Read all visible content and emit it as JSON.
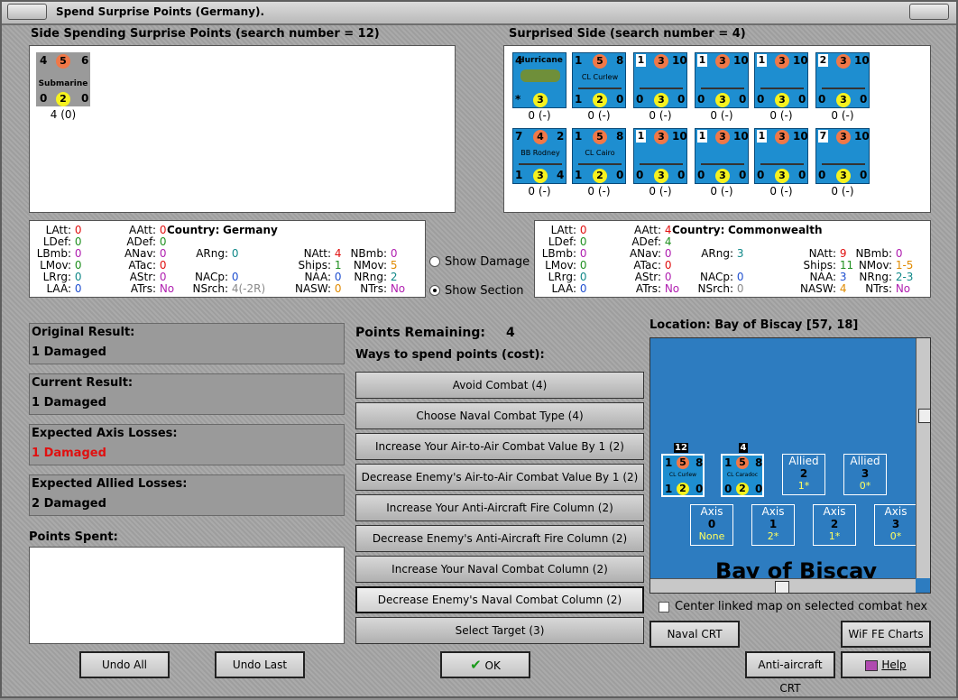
{
  "window": {
    "title": "Spend Surprise Points (Germany)."
  },
  "spending_side": {
    "heading": "Side Spending Surprise Points (search number = 12)",
    "units": [
      {
        "top_left": "4",
        "top_mid": "5",
        "top_right": "6",
        "name": "Submarine",
        "bot_left": "0",
        "bot_mid": "2",
        "bot_right": "0",
        "value": "4 (0)"
      }
    ]
  },
  "surprised_side": {
    "heading": "Surprised Side (search number = 4)",
    "units": [
      {
        "tl": "4",
        "tm": "",
        "tr": "",
        "name": "Hurricane",
        "bl": "*",
        "bm": "3",
        "br": "",
        "value": "0 (-)",
        "kind": "air"
      },
      {
        "tl": "1",
        "tm": "5",
        "tr": "8",
        "name": "CL Curlew",
        "bl": "1",
        "bm": "2",
        "br": "0",
        "value": "0 (-)",
        "kind": "ship"
      },
      {
        "tl": "1",
        "tm": "3",
        "tr": "10",
        "name": "",
        "bl": "0",
        "bm": "3",
        "br": "0",
        "value": "0 (-)",
        "kind": "ship"
      },
      {
        "tl": "1",
        "tm": "3",
        "tr": "10",
        "name": "",
        "bl": "0",
        "bm": "3",
        "br": "0",
        "value": "0 (-)",
        "kind": "ship"
      },
      {
        "tl": "1",
        "tm": "3",
        "tr": "10",
        "name": "",
        "bl": "0",
        "bm": "3",
        "br": "0",
        "value": "0 (-)",
        "kind": "ship"
      },
      {
        "tl": "2",
        "tm": "3",
        "tr": "10",
        "name": "",
        "bl": "0",
        "bm": "3",
        "br": "0",
        "value": "0 (-)",
        "kind": "ship"
      },
      {
        "tl": "7",
        "tm": "4",
        "tr": "2",
        "name": "BB Rodney",
        "bl": "1",
        "bm": "3",
        "br": "4",
        "value": "0 (-)",
        "kind": "ship"
      },
      {
        "tl": "1",
        "tm": "5",
        "tr": "8",
        "name": "CL Cairo",
        "bl": "1",
        "bm": "2",
        "br": "0",
        "value": "0 (-)",
        "kind": "ship"
      },
      {
        "tl": "1",
        "tm": "3",
        "tr": "10",
        "name": "",
        "bl": "0",
        "bm": "3",
        "br": "0",
        "value": "0 (-)",
        "kind": "ship"
      },
      {
        "tl": "1",
        "tm": "3",
        "tr": "10",
        "name": "",
        "bl": "0",
        "bm": "3",
        "br": "0",
        "value": "0 (-)",
        "kind": "ship"
      },
      {
        "tl": "1",
        "tm": "3",
        "tr": "10",
        "name": "",
        "bl": "0",
        "bm": "3",
        "br": "0",
        "value": "0 (-)",
        "kind": "ship"
      },
      {
        "tl": "7",
        "tm": "3",
        "tr": "10",
        "name": "",
        "bl": "0",
        "bm": "3",
        "br": "0",
        "value": "0 (-)",
        "kind": "ship"
      }
    ]
  },
  "stats_left": {
    "country_label": "Country:",
    "country": "Germany",
    "items": [
      {
        "k": "LAtt:",
        "v": "0",
        "c": "red"
      },
      {
        "k": "AAtt:",
        "v": "0",
        "c": "red"
      },
      {
        "k": "LDef:",
        "v": "0",
        "c": "grn"
      },
      {
        "k": "ADef:",
        "v": "0",
        "c": "grn"
      },
      {
        "k": "LBmb:",
        "v": "0",
        "c": "prp"
      },
      {
        "k": "ANav:",
        "v": "0",
        "c": "prp"
      },
      {
        "k": "ARng:",
        "v": "0",
        "c": "tea"
      },
      {
        "k": "NAtt:",
        "v": "4",
        "c": "red"
      },
      {
        "k": "NBmb:",
        "v": "0",
        "c": "prp"
      },
      {
        "k": "LMov:",
        "v": "0",
        "c": "grn"
      },
      {
        "k": "ATac:",
        "v": "0",
        "c": "red"
      },
      {
        "k": "Ships:",
        "v": "1",
        "c": "grn"
      },
      {
        "k": "NMov:",
        "v": "5",
        "c": "orn"
      },
      {
        "k": "LRrg:",
        "v": "0",
        "c": "tea"
      },
      {
        "k": "AStr:",
        "v": "0",
        "c": "prp"
      },
      {
        "k": "NACp:",
        "v": "0",
        "c": "blu"
      },
      {
        "k": "NAA:",
        "v": "0",
        "c": "blu"
      },
      {
        "k": "NRng:",
        "v": "2",
        "c": "tea"
      },
      {
        "k": "LAA:",
        "v": "0",
        "c": "blu"
      },
      {
        "k": "ATrs:",
        "v": "No",
        "c": "prp"
      },
      {
        "k": "NSrch:",
        "v": "4(-2R)",
        "c": "gry"
      },
      {
        "k": "NASW:",
        "v": "0",
        "c": "orn"
      },
      {
        "k": "NTrs:",
        "v": "No",
        "c": "prp"
      }
    ]
  },
  "stats_right": {
    "country_label": "Country:",
    "country": "Commonwealth",
    "items": [
      {
        "k": "LAtt:",
        "v": "0",
        "c": "red"
      },
      {
        "k": "AAtt:",
        "v": "4",
        "c": "red"
      },
      {
        "k": "LDef:",
        "v": "0",
        "c": "grn"
      },
      {
        "k": "ADef:",
        "v": "4",
        "c": "grn"
      },
      {
        "k": "LBmb:",
        "v": "0",
        "c": "prp"
      },
      {
        "k": "ANav:",
        "v": "0",
        "c": "prp"
      },
      {
        "k": "ARng:",
        "v": "3",
        "c": "tea"
      },
      {
        "k": "NAtt:",
        "v": "9",
        "c": "red"
      },
      {
        "k": "NBmb:",
        "v": "0",
        "c": "prp"
      },
      {
        "k": "LMov:",
        "v": "0",
        "c": "grn"
      },
      {
        "k": "ATac:",
        "v": "0",
        "c": "red"
      },
      {
        "k": "Ships:",
        "v": "11",
        "c": "grn"
      },
      {
        "k": "NMov:",
        "v": "1-5",
        "c": "orn"
      },
      {
        "k": "LRrg:",
        "v": "0",
        "c": "tea"
      },
      {
        "k": "AStr:",
        "v": "0",
        "c": "prp"
      },
      {
        "k": "NACp:",
        "v": "0",
        "c": "blu"
      },
      {
        "k": "NAA:",
        "v": "3",
        "c": "blu"
      },
      {
        "k": "NRng:",
        "v": "2-3",
        "c": "tea"
      },
      {
        "k": "LAA:",
        "v": "0",
        "c": "blu"
      },
      {
        "k": "ATrs:",
        "v": "No",
        "c": "prp"
      },
      {
        "k": "NSrch:",
        "v": "0",
        "c": "gry"
      },
      {
        "k": "NASW:",
        "v": "4",
        "c": "orn"
      },
      {
        "k": "NTrs:",
        "v": "No",
        "c": "prp"
      }
    ]
  },
  "show_options": {
    "damage": "Show Damage",
    "section": "Show Section",
    "selected": "section"
  },
  "results": {
    "original": {
      "label": "Original Result:",
      "value": "1 Damaged"
    },
    "current": {
      "label": "Current Result:",
      "value": "1 Damaged"
    },
    "axis": {
      "label": "Expected Axis Losses:",
      "value": "1 Damaged"
    },
    "allied": {
      "label": "Expected Allied Losses:",
      "value": "2 Damaged"
    },
    "spent_label": "Points Spent:"
  },
  "points": {
    "label": "Points Remaining:",
    "value": "4",
    "ways": "Ways to spend points (cost):"
  },
  "options": [
    "Avoid Combat (4)",
    "Choose Naval Combat Type (4)",
    "Increase Your Air-to-Air Combat Value By 1 (2)",
    "Decrease Enemy's Air-to-Air Combat Value By 1 (2)",
    "Increase Your Anti-Aircraft Fire Column (2)",
    "Decrease Enemy's Anti-Aircraft Fire Column (2)",
    "Increase Your Naval Combat Column (2)",
    "Decrease Enemy's Naval Combat Column (2)",
    "Select Target (3)"
  ],
  "map": {
    "location": "Location: Bay of Biscay [57, 18]",
    "name": "Bay of Biscay",
    "stack1": {
      "count": "12",
      "tl": "1",
      "tm": "5",
      "tr": "8",
      "name": "CL Curlew",
      "bl": "1",
      "bm": "2",
      "br": "0"
    },
    "stack2": {
      "count": "4",
      "tl": "1",
      "tm": "5",
      "tr": "8",
      "name": "CL Caradoc",
      "bl": "0",
      "bm": "2",
      "br": "0"
    },
    "allied": [
      {
        "t": "Allied",
        "n": "2",
        "s": "1*"
      },
      {
        "t": "Allied",
        "n": "3",
        "s": "0*"
      }
    ],
    "axis": [
      {
        "t": "Axis",
        "n": "0",
        "s": "None"
      },
      {
        "t": "Axis",
        "n": "1",
        "s": "2*"
      },
      {
        "t": "Axis",
        "n": "2",
        "s": "1*"
      },
      {
        "t": "Axis",
        "n": "3",
        "s": "0*"
      }
    ],
    "center_linked": "Center linked map on selected combat hex"
  },
  "buttons": {
    "undo_all": "Undo All",
    "undo_last": "Undo Last",
    "ok": "OK",
    "naval_crt": "Naval CRT",
    "wif_charts": "WiF FE Charts",
    "aa_crt": "Anti-aircraft CRT",
    "help": "Help"
  }
}
